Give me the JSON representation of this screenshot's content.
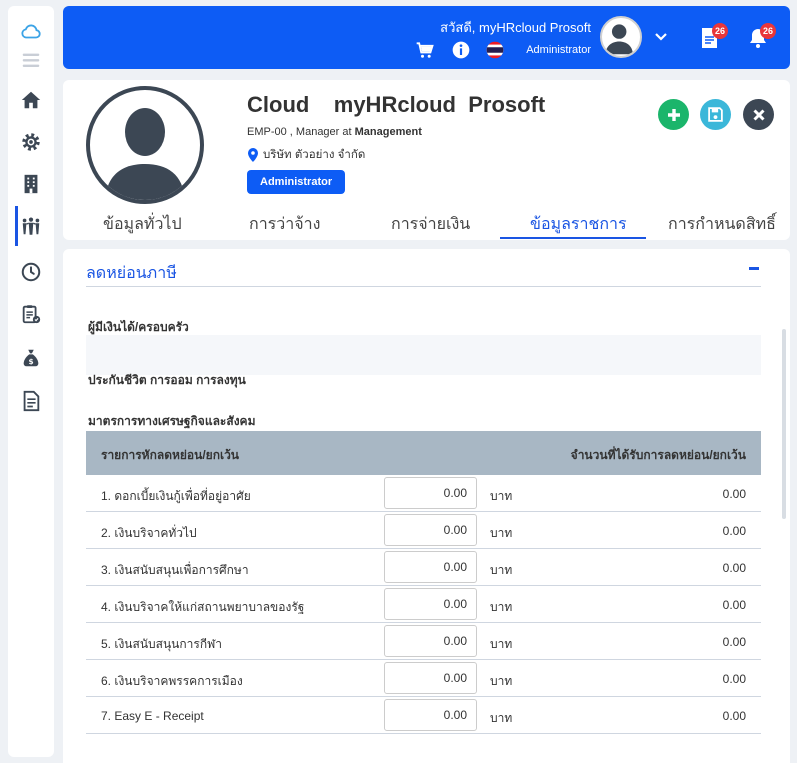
{
  "sidebar": {
    "items": [
      {
        "icon": "cloud-icon"
      },
      {
        "icon": "menu-icon"
      },
      {
        "icon": "home-icon"
      },
      {
        "icon": "settings-gear-icon"
      },
      {
        "icon": "building-icon"
      },
      {
        "icon": "people-icon",
        "active": true
      },
      {
        "icon": "clock-icon"
      },
      {
        "icon": "clipboard-check-icon"
      },
      {
        "icon": "money-bag-icon"
      },
      {
        "icon": "document-icon"
      }
    ],
    "accent": "#1a55e3"
  },
  "topbar": {
    "greeting": "สวัสดี, myHRcloud Prosoft",
    "role": "Administrator",
    "doc_badge": "26",
    "bell_badge": "26",
    "bg_color": "#0d5cf5"
  },
  "profile": {
    "name": "Cloud    myHRcloud  Prosoft",
    "emp_code": "EMP-00",
    "position_text": " , Manager at ",
    "department": "Management",
    "company": "บริษัท ตัวอย่าง จำกัด",
    "role_badge": "Administrator",
    "actions": {
      "add_color": "#1bb56b",
      "save_color": "#3bb7d9",
      "close_color": "#3c4754"
    }
  },
  "tabs": [
    {
      "label": "ข้อมูลทั่วไป"
    },
    {
      "label": "การว่าจ้าง"
    },
    {
      "label": "การจ่ายเงิน"
    },
    {
      "label": "ข้อมูลราชการ",
      "active": true
    },
    {
      "label": "การกำหนดสิทธิ์"
    }
  ],
  "section": {
    "title": "ลดหย่อนภาษี",
    "sub1": "ผู้มีเงินได้/ครอบครัว",
    "sub2": "ประกันชีวิต การออม การลงทุน",
    "sub3": "มาตรการทางเศรษฐกิจและสังคม"
  },
  "table": {
    "col1": "รายการหักลดหย่อน/ยกเว้น",
    "col2": "จำนวนที่ได้รับการลดหย่อน/ยกเว้น",
    "rows": [
      {
        "label": "1. ดอกเบี้ยเงินกู้เพื่อที่อยู่อาศัย",
        "input": "0.00",
        "unit": "บาท",
        "amount": "0.00"
      },
      {
        "label": "2. เงินบริจาคทั่วไป",
        "input": "0.00",
        "unit": "บาท",
        "amount": "0.00"
      },
      {
        "label": "3. เงินสนับสนุนเพื่อการศึกษา",
        "input": "0.00",
        "unit": "บาท",
        "amount": "0.00"
      },
      {
        "label": "4. เงินบริจาคให้แก่สถานพยาบาลของรัฐ",
        "input": "0.00",
        "unit": "บาท",
        "amount": "0.00"
      },
      {
        "label": "5. เงินสนับสนุนการกีฬา",
        "input": "0.00",
        "unit": "บาท",
        "amount": "0.00"
      },
      {
        "label": "6. เงินบริจาคพรรคการเมือง",
        "input": "0.00",
        "unit": "บาท",
        "amount": "0.00"
      },
      {
        "label": "7. Easy E - Receipt",
        "input": "0.00",
        "unit": "บาท",
        "amount": "0.00"
      }
    ]
  }
}
